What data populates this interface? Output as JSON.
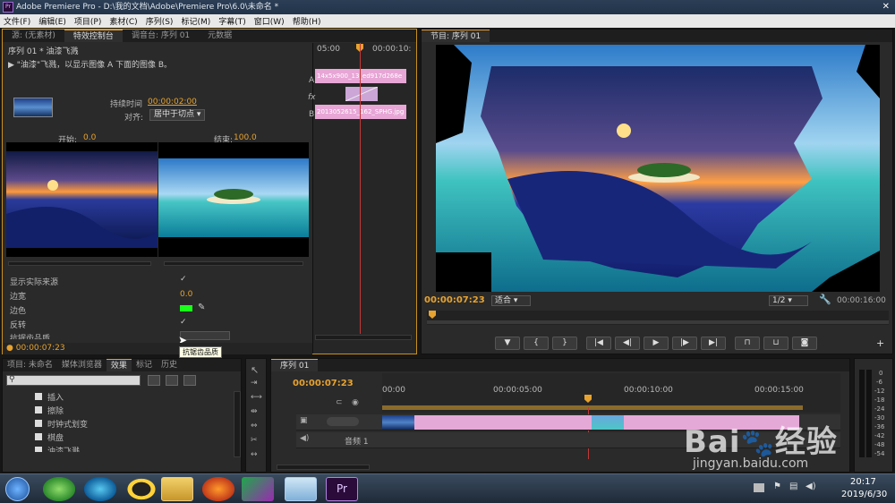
{
  "window": {
    "title": "Adobe Premiere Pro - D:\\我的文档\\Adobe\\Premiere Pro\\6.0\\未命名 *"
  },
  "menu": [
    "文件(F)",
    "编辑(E)",
    "项目(P)",
    "素材(C)",
    "序列(S)",
    "标记(M)",
    "字幕(T)",
    "窗口(W)",
    "帮助(H)"
  ],
  "left_tabs": [
    "源: (无素材)",
    "特效控制台",
    "调音台: 序列 01",
    "元数据"
  ],
  "effect": {
    "header": "序列 01 * 油漆飞溅",
    "desc": "\"油漆\"飞溅，以显示图像 A 下面的图像 B。",
    "duration_label": "持续时间",
    "duration_value": "00:00:02:00",
    "align_label": "对齐:",
    "align_value": "居中于切点",
    "start_label": "开始:",
    "start_value": "0.0",
    "end_label": "结束:",
    "end_value": "100.0",
    "show_source": "显示实际来源",
    "border_width": "边宽",
    "border_width_value": "0.0",
    "border_color": "边色",
    "reverse": "反转",
    "antialias": "抗锯齿品质",
    "timecode": "00:00:07:23",
    "tooltip": "抗锯齿品质",
    "mini_tl_t0": "05:00",
    "mini_tl_t1": "00:00:10:",
    "clip_a": "14x5x900_13_ed917d268e",
    "clip_b": "2013052615_162_SPHG.jpg",
    "track_a": "A",
    "track_b": "B",
    "fx": "fx"
  },
  "program": {
    "tab": "节目: 序列 01",
    "timecode": "00:00:07:23",
    "fit": "适合",
    "ratio": "1/2",
    "end_time": "00:00:16:00"
  },
  "project_tabs": [
    "项目: 未命名",
    "媒体浏览器",
    "效果",
    "标记",
    "历史"
  ],
  "effects_list": [
    "插入",
    "擦除",
    "时钟式划变",
    "棋盘",
    "油漆飞溅"
  ],
  "timeline": {
    "tab": "序列 01",
    "timecode": "00:00:07:23",
    "ticks": [
      "00:00",
      "00:00:05:00",
      "00:00:10:00",
      "00:00:15:00"
    ],
    "audio_track": "音频 1"
  },
  "audio_meter": {
    "labels": [
      "0",
      "-6",
      "-12",
      "-18",
      "-24",
      "-30",
      "-36",
      "-42",
      "-48",
      "-54"
    ]
  },
  "taskbar": {
    "time": "20:17",
    "date": "2019/6/30"
  },
  "watermark": {
    "text": "jingyan.baidu.com"
  }
}
